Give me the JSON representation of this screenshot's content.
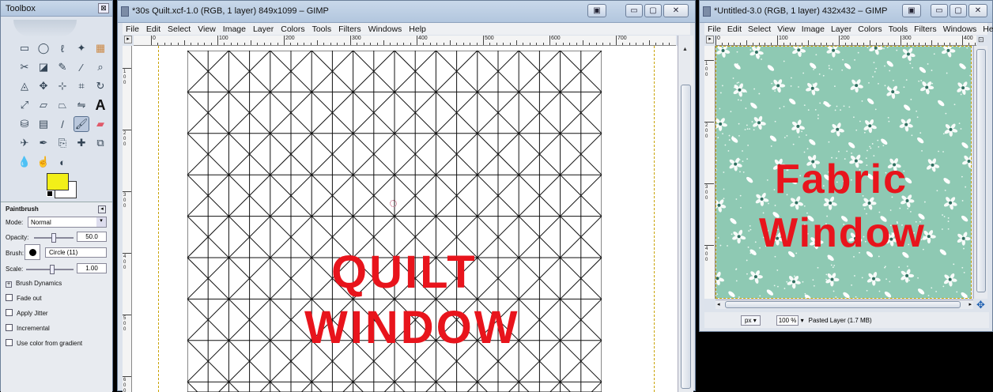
{
  "toolbox": {
    "title": "Toolbox",
    "close_glyph": "⊠",
    "tool_icons": [
      "rect-select-icon",
      "ellipse-select-icon",
      "free-select-icon",
      "fuzzy-select-icon",
      "color-select-icon",
      "scissors-icon",
      "foreground-select-icon",
      "paths-icon",
      "color-picker-icon",
      "zoom-icon",
      "measure-icon",
      "move-icon",
      "align-icon",
      "crop-icon",
      "rotate-icon",
      "scale-icon",
      "shear-icon",
      "perspective-icon",
      "flip-icon",
      "text-icon",
      "bucket-fill-icon",
      "blend-icon",
      "pencil-icon",
      "paintbrush-icon",
      "eraser-icon",
      "airbrush-icon",
      "ink-icon",
      "clone-icon",
      "heal-icon",
      "perspective-clone-icon",
      "blur-icon",
      "smudge-icon",
      "dodge-icon"
    ],
    "fg_color": "#f2ef18",
    "bg_color": "#ffffff",
    "options": {
      "section_title": "Paintbrush",
      "mode_label": "Mode:",
      "mode_value": "Normal",
      "opacity_label": "Opacity:",
      "opacity_value": "50.0",
      "opacity_level": 0.5,
      "brush_label": "Brush:",
      "brush_value": "Circle (11)",
      "scale_label": "Scale:",
      "scale_value": "1.00",
      "dynamics_label": "Brush Dynamics",
      "fade_label": "Fade out",
      "jitter_label": "Apply Jitter",
      "incremental_label": "Incremental",
      "gradient_label": "Use color from gradient"
    }
  },
  "quilt_window": {
    "title": "*30s Quilt.xcf-1.0 (RGB, 1 layer) 849x1099 – GIMP",
    "menu": [
      "File",
      "Edit",
      "Select",
      "View",
      "Image",
      "Layer",
      "Colors",
      "Tools",
      "Filters",
      "Windows",
      "Help"
    ],
    "ruler_labels": [
      "0",
      "100",
      "200",
      "300",
      "400",
      "500",
      "600",
      "700",
      "800"
    ],
    "vruler_labels": [
      "1 0 0",
      "2 0 0",
      "3 0 0",
      "4 0 0",
      "5 0 0",
      "6 0 0"
    ],
    "overlay_line1": "QUILT",
    "overlay_line2": "WINDOW"
  },
  "fabric_window": {
    "title": "*Untitled-3.0 (RGB, 1 layer) 432x432 – GIMP",
    "menu": [
      "File",
      "Edit",
      "Select",
      "View",
      "Image",
      "Layer",
      "Colors",
      "Tools",
      "Filters",
      "Windows",
      "Help"
    ],
    "ruler_labels": [
      "0",
      "100",
      "200",
      "300",
      "400"
    ],
    "fabric_color": "#8ec9b3",
    "overlay_line1": "Fabric",
    "overlay_line2": "Window",
    "unit": "px",
    "zoom": "100 %",
    "status": "Pasted Layer (1.7 MB)"
  }
}
